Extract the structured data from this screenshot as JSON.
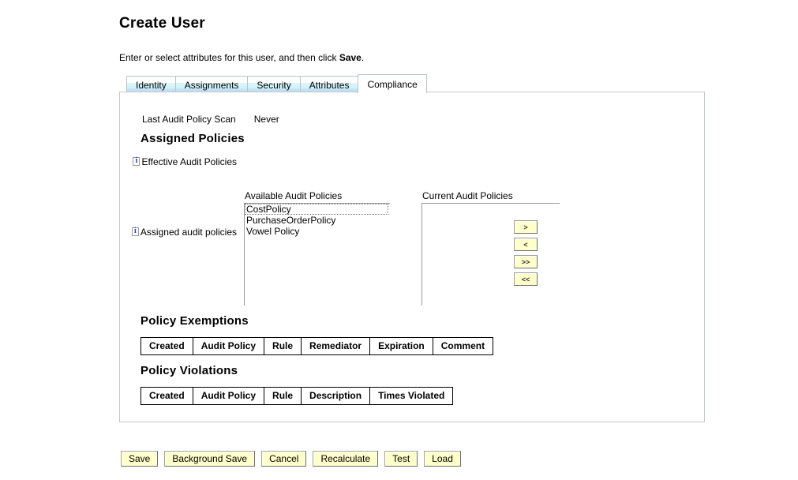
{
  "page": {
    "title": "Create User",
    "instruction_before": "Enter or select attributes for this user, and then click ",
    "instruction_bold": "Save",
    "instruction_after": "."
  },
  "tabs": [
    {
      "label": "Identity",
      "active": false
    },
    {
      "label": "Assignments",
      "active": false
    },
    {
      "label": "Security",
      "active": false
    },
    {
      "label": "Attributes",
      "active": false
    },
    {
      "label": "Compliance",
      "active": true
    }
  ],
  "compliance": {
    "last_scan_label": "Last Audit Policy Scan",
    "last_scan_value": "Never",
    "assigned_policies_heading": "Assigned Policies",
    "effective_audit_policies_label": "Effective Audit Policies",
    "assigned_audit_policies_label": "Assigned audit policies",
    "dual_list": {
      "available_title": "Available Audit Policies",
      "current_title": "Current Audit Policies",
      "available_options": [
        "CostPolicy",
        "PurchaseOrderPolicy",
        "Vowel Policy"
      ],
      "selected_available": "CostPolicy",
      "current_options": [],
      "buttons": [
        {
          "label": ">",
          "name": "move-right-button"
        },
        {
          "label": "<",
          "name": "move-left-button"
        },
        {
          "label": ">>",
          "name": "move-all-right-button"
        },
        {
          "label": "<<",
          "name": "move-all-left-button"
        }
      ]
    },
    "policy_exemptions": {
      "heading": "Policy Exemptions",
      "columns": [
        "Created",
        "Audit Policy",
        "Rule",
        "Remediator",
        "Expiration",
        "Comment"
      ],
      "rows": []
    },
    "policy_violations": {
      "heading": "Policy Violations",
      "columns": [
        "Created",
        "Audit Policy",
        "Rule",
        "Description",
        "Times Violated"
      ],
      "rows": []
    }
  },
  "actions": [
    {
      "label": "Save",
      "name": "save-button"
    },
    {
      "label": "Background Save",
      "name": "background-save-button"
    },
    {
      "label": "Cancel",
      "name": "cancel-button"
    },
    {
      "label": "Recalculate",
      "name": "recalculate-button"
    },
    {
      "label": "Test",
      "name": "test-button"
    },
    {
      "label": "Load",
      "name": "load-button"
    }
  ],
  "colors": {
    "tab_inactive_accent": "#ccf2fb",
    "button_face": "#ffffcc",
    "panel_border": "#c3c9cb",
    "info_icon_letter": "#1a3fd4"
  }
}
